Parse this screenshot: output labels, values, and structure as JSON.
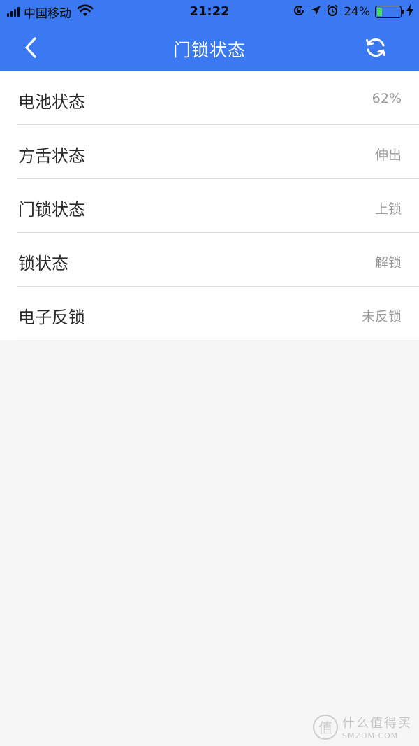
{
  "status_bar": {
    "carrier": "中国移动",
    "time": "21:22",
    "battery_percent": "24%",
    "battery_level": 0.24,
    "icons": [
      "signal-icon",
      "wifi-icon",
      "rotation-lock-icon",
      "location-icon",
      "alarm-icon",
      "battery-icon",
      "charging-icon"
    ]
  },
  "nav": {
    "title": "门锁状态",
    "back_icon": "chevron-left-icon",
    "refresh_icon": "refresh-icon"
  },
  "rows": [
    {
      "label": "电池状态",
      "value": "62%"
    },
    {
      "label": "方舌状态",
      "value": "伸出"
    },
    {
      "label": "门锁状态",
      "value": "上锁"
    },
    {
      "label": "锁状态",
      "value": "解锁"
    },
    {
      "label": "电子反锁",
      "value": "未反锁"
    }
  ],
  "watermark": {
    "seal": "值",
    "name": "什么值得买",
    "domain": "SMZDM.COM"
  },
  "colors": {
    "accent": "#3a79f2",
    "background": "#f6f6f6",
    "label": "#2b2b2b",
    "value": "#9a9a9a",
    "battery_fill": "#4cd964"
  }
}
